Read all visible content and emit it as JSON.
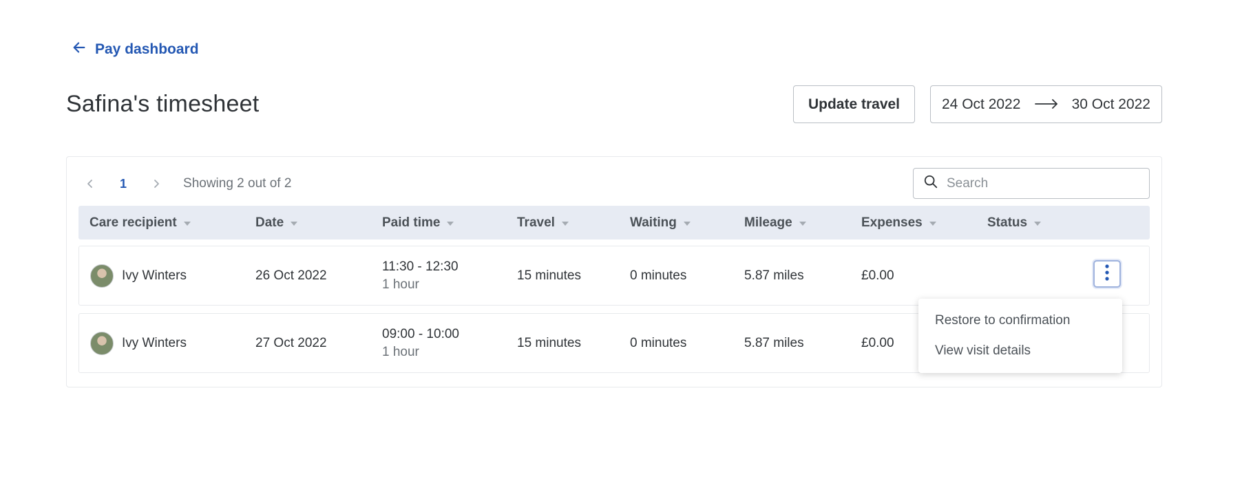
{
  "nav": {
    "back_label": "Pay dashboard"
  },
  "header": {
    "title": "Safina's timesheet",
    "update_travel_label": "Update travel",
    "date_from": "24 Oct 2022",
    "date_to": "30 Oct 2022"
  },
  "pagination": {
    "current_page": "1",
    "showing": "Showing 2 out of 2"
  },
  "search": {
    "placeholder": "Search",
    "value": ""
  },
  "table": {
    "columns": [
      "Care recipient",
      "Date",
      "Paid time",
      "Travel",
      "Waiting",
      "Mileage",
      "Expenses",
      "Status"
    ],
    "rows": [
      {
        "name": "Ivy Winters",
        "date": "26 Oct 2022",
        "paid_time": "11:30 - 12:30",
        "paid_duration": "1 hour",
        "travel": "15 minutes",
        "waiting": "0 minutes",
        "mileage": "5.87 miles",
        "expenses": "£0.00",
        "status": ""
      },
      {
        "name": "Ivy Winters",
        "date": "27 Oct 2022",
        "paid_time": "09:00 - 10:00",
        "paid_duration": "1 hour",
        "travel": "15 minutes",
        "waiting": "0 minutes",
        "mileage": "5.87 miles",
        "expenses": "£0.00",
        "status": ""
      }
    ]
  },
  "row_menu": {
    "items": [
      "Restore to confirmation",
      "View visit details"
    ]
  },
  "colors": {
    "accent": "#2458b3",
    "header_bg": "#e7ebf3",
    "border": "#b9bec4"
  },
  "icons": {
    "back": "arrow-left-icon",
    "range": "arrow-right-icon",
    "search": "search-icon",
    "prev": "chevron-left-icon",
    "next": "chevron-right-icon",
    "more": "kebab-menu-icon",
    "sort": "sort-caret-icon"
  }
}
